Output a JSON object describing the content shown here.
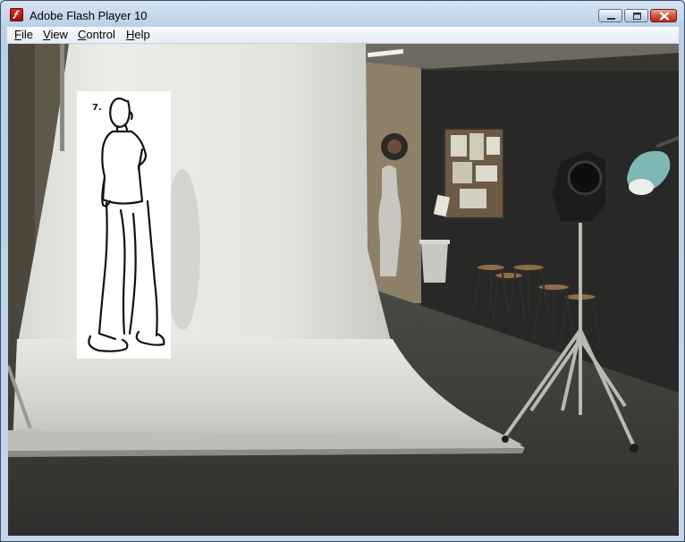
{
  "window": {
    "title": "Adobe Flash Player 10"
  },
  "menu": {
    "items": [
      {
        "accel": "F",
        "rest": "ile"
      },
      {
        "accel": "V",
        "rest": "iew"
      },
      {
        "accel": "C",
        "rest": "ontrol"
      },
      {
        "accel": "H",
        "rest": "elp"
      }
    ]
  },
  "video": {
    "card_number": "7."
  }
}
